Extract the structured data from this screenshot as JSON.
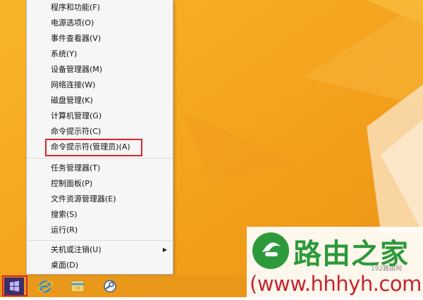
{
  "menu": {
    "items": [
      {
        "label": "程序和功能(F)"
      },
      {
        "label": "电源选项(O)"
      },
      {
        "label": "事件查看器(V)"
      },
      {
        "label": "系统(Y)"
      },
      {
        "label": "设备管理器(M)"
      },
      {
        "label": "网络连接(W)"
      },
      {
        "label": "磁盘管理(K)"
      },
      {
        "label": "计算机管理(G)"
      },
      {
        "label": "命令提示符(C)"
      },
      {
        "label": "命令提示符(管理员)(A)"
      },
      {
        "label": "任务管理器(T)"
      },
      {
        "label": "控制面板(P)"
      },
      {
        "label": "文件资源管理器(E)"
      },
      {
        "label": "搜索(S)"
      },
      {
        "label": "运行(R)"
      },
      {
        "label": "关机或注销(U)"
      },
      {
        "label": "桌面(D)"
      }
    ]
  },
  "taskbar": {
    "icons": [
      "windows-logo-icon",
      "internet-explorer-icon",
      "file-explorer-icon",
      "steam-icon"
    ]
  },
  "watermark": {
    "title": "路由之家",
    "url": "(www.hhhyh.com)",
    "small": "192路由网"
  },
  "colors": {
    "wallpaper": "#f5a623",
    "highlight": "#d9252b",
    "watermark_green": "#2c9a3a",
    "watermark_red": "#c8232c"
  }
}
